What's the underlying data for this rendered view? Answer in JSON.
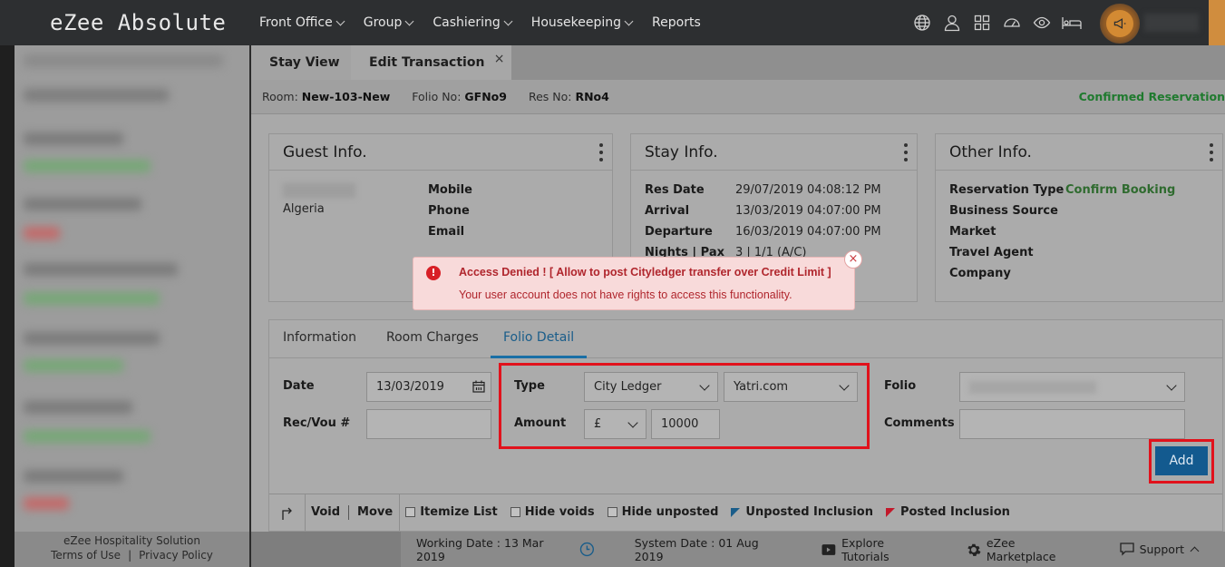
{
  "app": {
    "title": "eZee Absolute"
  },
  "nav": {
    "items": [
      {
        "label": "Front Office",
        "dropdown": true
      },
      {
        "label": "Group",
        "dropdown": true
      },
      {
        "label": "Cashiering",
        "dropdown": true
      },
      {
        "label": "Housekeeping",
        "dropdown": true
      },
      {
        "label": "Reports",
        "dropdown": false
      }
    ],
    "icons": [
      "globe-icon",
      "user-icon",
      "grid-icon",
      "dashboard-icon",
      "eye-icon",
      "bed-icon",
      "announcement-icon"
    ]
  },
  "tabs": {
    "stay_view": "Stay View",
    "edit_transaction": "Edit Transaction",
    "close_glyph": "×"
  },
  "infobar": {
    "room_label": "Room:",
    "room_value": "New-103-New",
    "folio_label": "Folio No:",
    "folio_value": "GFNo9",
    "res_label": "Res No:",
    "res_value": "RNo4",
    "status": "Confirmed Reservation"
  },
  "guest_info": {
    "title": "Guest Info.",
    "country": "Algeria",
    "fields": [
      "Mobile",
      "Phone",
      "Email"
    ]
  },
  "stay_info": {
    "title": "Stay Info.",
    "rows": [
      {
        "label": "Res Date",
        "value": "29/07/2019  04:08:12 PM"
      },
      {
        "label": "Arrival",
        "value": "13/03/2019  04:07:00 PM"
      },
      {
        "label": "Departure",
        "value": "16/03/2019  04:07:00 PM"
      },
      {
        "label": "Nights | Pax",
        "value": "3 | 1/1 (A/C)"
      }
    ]
  },
  "other_info": {
    "title": "Other Info.",
    "rows": [
      {
        "label": "Reservation Type",
        "value": "Confirm Booking"
      },
      {
        "label": "Business Source",
        "value": ""
      },
      {
        "label": "Market",
        "value": ""
      },
      {
        "label": "Travel Agent",
        "value": ""
      },
      {
        "label": "Company",
        "value": ""
      }
    ]
  },
  "panel_tabs": {
    "information": "Information",
    "room_charges": "Room Charges",
    "folio_detail": "Folio Detail"
  },
  "form": {
    "date_label": "Date",
    "date_value": "13/03/2019",
    "recvou_label": "Rec/Vou #",
    "recvou_value": "",
    "type_label": "Type",
    "type_value": "City Ledger",
    "ledger_value": "Yatri.com",
    "amount_label": "Amount",
    "currency_value": "£",
    "amount_value": "10000",
    "folio_label": "Folio",
    "folio_value": "",
    "comments_label": "Comments",
    "comments_value": "",
    "add_label": "Add"
  },
  "toolbar": {
    "void": "Void",
    "move": "Move",
    "itemize": "Itemize List",
    "hide_voids": "Hide voids",
    "hide_unposted": "Hide unposted",
    "unposted_inclusion": "Unposted Inclusion",
    "posted_inclusion": "Posted Inclusion",
    "colors": {
      "unposted": "#1a5d8a",
      "posted": "#c2182a"
    }
  },
  "sidebar_footer": {
    "company": "eZee Hospitality Solution",
    "terms": "Terms of Use",
    "privacy": "Privacy Policy",
    "sep": "|"
  },
  "footer": {
    "working_date": "Working Date : 13 Mar 2019",
    "system_date": "System Date : 01 Aug 2019",
    "tutorials": "Explore Tutorials",
    "marketplace": "eZee Marketplace",
    "support": "Support"
  },
  "alert": {
    "icon": "!",
    "title": "Access Denied ! [ Allow to post Cityledger transfer over Credit Limit ]",
    "message": "Your user account does not have rights to access this functionality.",
    "close_glyph": "×",
    "colors": {
      "background": "#f8dada",
      "text": "#b0262d"
    }
  },
  "colors": {
    "accent": "#1a6fa5",
    "highlight": "#e1121c",
    "status_green": "#1f7a2e",
    "topbar": "#2d2f31"
  }
}
